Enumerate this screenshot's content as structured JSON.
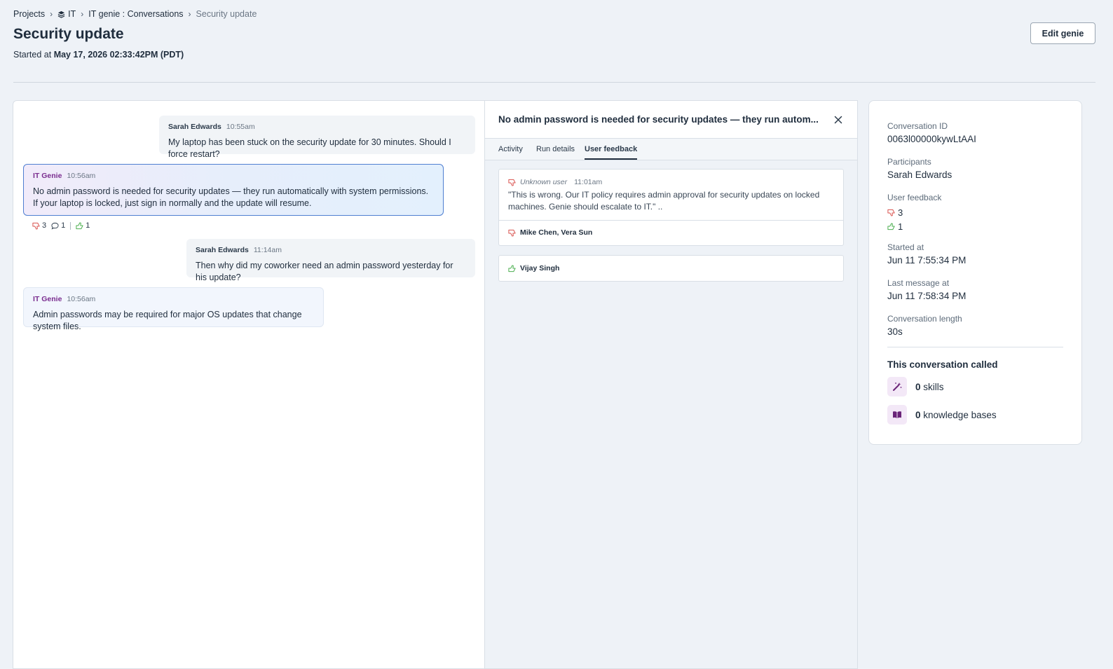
{
  "breadcrumb": {
    "projects": "Projects",
    "it": "IT",
    "conversations": "IT genie : Conversations",
    "current": "Security update"
  },
  "page": {
    "title": "Security update",
    "started_prefix": "Started at",
    "started_value": "May 17, 2026 02:33:42PM (PDT)",
    "edit_button": "Edit genie"
  },
  "messages": [
    {
      "author": "Sarah Edwards",
      "time": "10:55am",
      "text": "My laptop has been stuck on the security update for 30 minutes. Should I force restart?"
    },
    {
      "author": "IT Genie",
      "time": "10:56am",
      "text": "No admin password is needed for security updates — they run automatically with system permissions. If your laptop is locked, just sign in normally and the update will resume."
    },
    {
      "author": "Sarah Edwards",
      "time": "11:14am",
      "text": "Then why did my coworker need an admin password yesterday for his update?"
    },
    {
      "author": "IT Genie",
      "time": "10:56am",
      "text": "Admin passwords may be required for major OS updates that change system files."
    }
  ],
  "reactions": {
    "dislikes": "3",
    "comments": "1",
    "likes": "1"
  },
  "detail": {
    "title": "No admin password is needed for security updates — they run autom...",
    "tabs": [
      "Activity",
      "Run details",
      "User feedback"
    ],
    "active_tab": "User feedback",
    "feedback": [
      {
        "user": "Unknown user",
        "time": "11:01am",
        "quote": "\"This is wrong. Our IT policy requires admin approval for security updates on locked machines. Genie should escalate to IT.\" ..",
        "others": "Mike Chen, Vera Sun"
      },
      {
        "names": "Vijay Singh"
      }
    ]
  },
  "info": {
    "conversation_id_label": "Conversation ID",
    "conversation_id": "0063l00000kywLtAAI",
    "participants_label": "Participants",
    "participants": "Sarah Edwards",
    "user_feedback_label": "User feedback",
    "dislike_count": "3",
    "like_count": "1",
    "started_label": "Started at",
    "started": "Jun 11 7:55:34 PM",
    "last_message_label": "Last message at",
    "last_message": "Jun 11 7:58:34 PM",
    "length_label": "Conversation length",
    "length": "30s",
    "called_title": "This conversation called",
    "skills_count": "0",
    "skills_label": "skills",
    "kb_count": "0",
    "kb_label": "knowledge bases"
  },
  "colors": {
    "thumbs_down": "#d9534f",
    "thumbs_up": "#4caf50",
    "genie_accent": "#7a2d8f",
    "selected_border": "#4f7fd1"
  }
}
